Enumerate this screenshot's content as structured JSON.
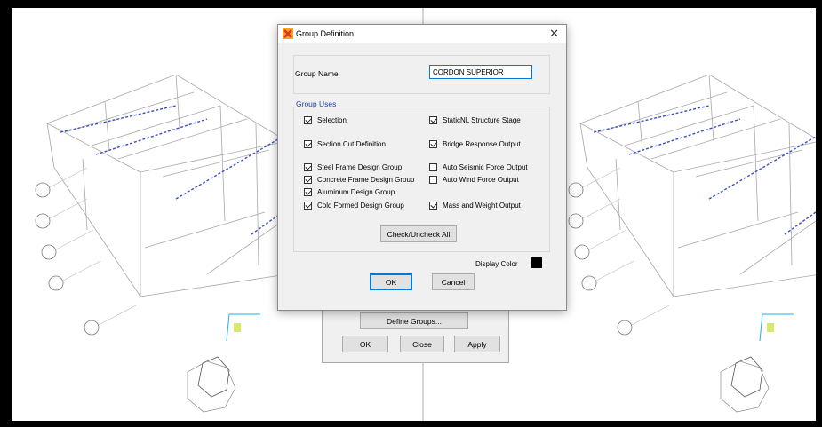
{
  "background_dialog": {
    "define_groups_label": "Define Groups...",
    "ok_label": "OK",
    "close_label": "Close",
    "apply_label": "Apply"
  },
  "group_definition": {
    "title": "Group Definition",
    "close_glyph": "✕",
    "group_name_label": "Group Name",
    "group_name_value": "CORDON SUPERIOR",
    "group_uses_title": "Group Uses",
    "uses": [
      {
        "label": "Selection",
        "checked": true
      },
      {
        "label": "Section Cut Definition",
        "checked": true
      },
      {
        "label": "Steel Frame Design Group",
        "checked": true
      },
      {
        "label": "Concrete Frame Design Group",
        "checked": true
      },
      {
        "label": "Aluminum Design Group",
        "checked": true
      },
      {
        "label": "Cold Formed Design Group",
        "checked": true
      },
      {
        "label": "StaticNL Structure Stage",
        "checked": true
      },
      {
        "label": "Bridge Response Output",
        "checked": true
      },
      {
        "label": "Auto Seismic Force Output",
        "checked": false
      },
      {
        "label": "Auto Wind Force Output",
        "checked": false
      },
      {
        "label": "Mass and Weight Output",
        "checked": true
      }
    ],
    "check_uncheck_label": "Check/Uncheck All",
    "display_color_label": "Display Color",
    "display_color": "#000000",
    "ok_label": "OK",
    "cancel_label": "Cancel"
  },
  "colors": {
    "accent": "#0078d7",
    "group_uses_text": "#1e3fb4",
    "model_selected": "#3b4fc4"
  }
}
